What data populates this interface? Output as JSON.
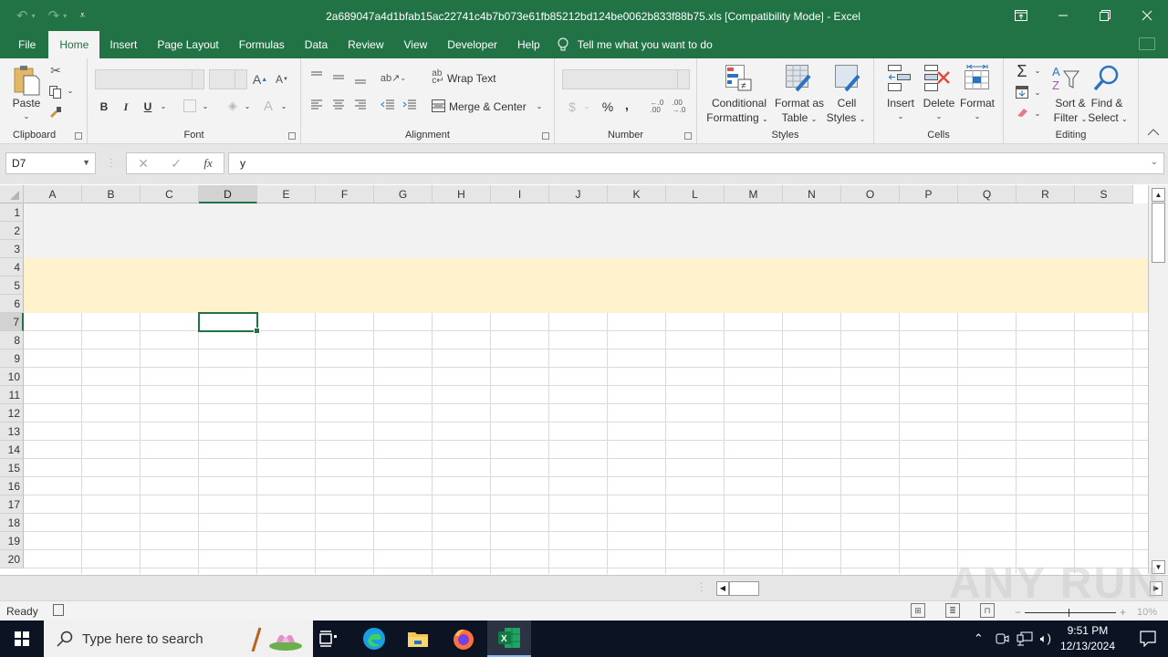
{
  "titlebar": {
    "title": "2a689047a4d1bfab15ac22741c4b7b073e61fb85212bd124be0062b833f88b75.xls  [Compatibility Mode]  -  Excel",
    "undo_icon": "undo-icon",
    "redo_icon": "redo-icon",
    "customize_icon": "customize-qat-icon",
    "window_controls": [
      "ribbon-display-options",
      "minimize",
      "restore",
      "close"
    ]
  },
  "tabs": {
    "items": [
      "File",
      "Home",
      "Insert",
      "Page Layout",
      "Formulas",
      "Data",
      "Review",
      "View",
      "Developer",
      "Help"
    ],
    "active": "Home",
    "tell_me": "Tell me what you want to do"
  },
  "ribbon": {
    "clipboard": {
      "label": "Clipboard",
      "paste": "Paste"
    },
    "font": {
      "label": "Font",
      "font_name": "",
      "font_size": "",
      "bold": "B",
      "italic": "I",
      "underline": "U"
    },
    "alignment": {
      "label": "Alignment",
      "wrap_text": "Wrap Text",
      "merge_center": "Merge & Center"
    },
    "number": {
      "label": "Number",
      "format": "",
      "currency": "$",
      "percent": "%",
      "comma": ",",
      "inc_decimal": "←.0 .00",
      "dec_decimal": ".00 →.0"
    },
    "styles": {
      "label": "Styles",
      "conditional_1": "Conditional",
      "conditional_2": "Formatting",
      "format_table_1": "Format as",
      "format_table_2": "Table",
      "cell_styles_1": "Cell",
      "cell_styles_2": "Styles"
    },
    "cells": {
      "label": "Cells",
      "insert": "Insert",
      "delete": "Delete",
      "format": "Format"
    },
    "editing": {
      "label": "Editing",
      "sort_1": "Sort &",
      "sort_2": "Filter",
      "find_1": "Find &",
      "find_2": "Select"
    }
  },
  "formula_bar": {
    "name_box": "D7",
    "formula": "y",
    "cancel": "✕",
    "enter": "✓",
    "fx": "fx"
  },
  "grid": {
    "columns": [
      "A",
      "B",
      "C",
      "D",
      "E",
      "F",
      "G",
      "H",
      "I",
      "J",
      "K",
      "L",
      "M",
      "N",
      "O",
      "P",
      "Q",
      "R",
      "S"
    ],
    "rows": [
      "1",
      "2",
      "3",
      "4",
      "5",
      "6",
      "7",
      "8",
      "9",
      "10",
      "11",
      "12",
      "13",
      "14",
      "15",
      "16",
      "17",
      "18",
      "19",
      "20"
    ],
    "selected_cell": "D7",
    "selected_column": "D",
    "selected_row": "7",
    "band_colors": {
      "rows_1_3": "#f2f2f2",
      "rows_4_6": "#fff2cc"
    },
    "accent": "#217346"
  },
  "status": {
    "ready": "Ready",
    "zoom": "10%"
  },
  "watermark": "ANY RUN",
  "taskbar": {
    "search_placeholder": "Type here to search",
    "time": "9:51 PM",
    "date": "12/13/2024",
    "apps": [
      "task-view",
      "edge",
      "file-explorer",
      "firefox",
      "excel"
    ]
  }
}
